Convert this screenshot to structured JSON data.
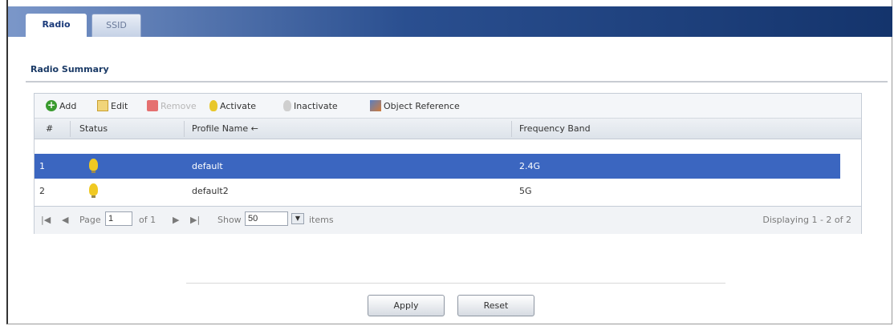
{
  "tabs": [
    {
      "label": "Radio",
      "active": true
    },
    {
      "label": "SSID",
      "active": false
    }
  ],
  "section": {
    "title": "Radio Summary"
  },
  "toolbar": {
    "add": "Add",
    "edit": "Edit",
    "remove": "Remove",
    "activate": "Activate",
    "inactivate": "Inactivate",
    "object_reference": "Object Reference"
  },
  "table": {
    "columns": [
      "#",
      "Status",
      "Profile Name",
      "Frequency Band"
    ],
    "sort_indicator": "←",
    "rows": [
      {
        "index": "1",
        "status": "active",
        "profile": "default",
        "band": "2.4G",
        "selected": true
      },
      {
        "index": "2",
        "status": "active",
        "profile": "default2",
        "band": "5G",
        "selected": false
      }
    ]
  },
  "pager": {
    "page_label": "Page",
    "page_value": "1",
    "of_label": "of 1",
    "show_label": "Show",
    "show_value": "50",
    "items_label": "items",
    "displaying": "Displaying 1 - 2 of 2"
  },
  "buttons": {
    "apply": "Apply",
    "reset": "Reset"
  },
  "colors": {
    "tabbar_dark": "#14346c",
    "selected_row": "#3b66c0",
    "bulb": "#f0c922"
  }
}
